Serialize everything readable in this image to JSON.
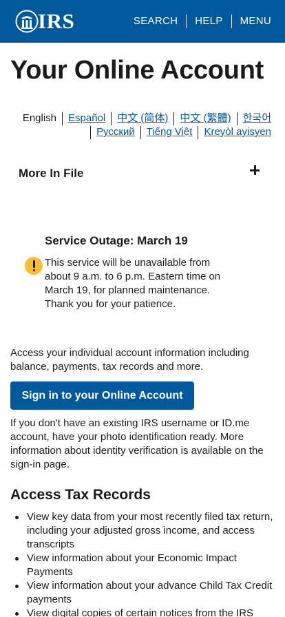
{
  "header": {
    "logo_text": "IRS",
    "logo_icon": "irs-eagle-logo",
    "nav": [
      "SEARCH",
      "HELP",
      "MENU"
    ],
    "brand_color": "#00599c"
  },
  "page": {
    "title": "Your Online Account"
  },
  "languages": {
    "current": "English",
    "row1_links": [
      "Español",
      "中文 (简体)",
      "中文 (繁體)",
      "한국어"
    ],
    "row2_links": [
      "Русский",
      "Tiếng Việt",
      "Kreyòl ayisyen"
    ]
  },
  "accordion": {
    "title": "More In File",
    "icon": "plus-icon"
  },
  "alert": {
    "icon": "exclamation-icon",
    "icon_color": "#ffbe2e",
    "heading": "Service Outage: March 19",
    "body": "This service will be unavailable from about 9 a.m. to 6 p.m. Eastern time on March 19, for planned maintenance. Thank you for your patience."
  },
  "intro": "Access your individual account information including balance, payments, tax records and more.",
  "signin_button": "Sign in to your Online Account",
  "help_text": "If you don't have an existing IRS username or ID.me account, have your photo identification ready. More information about identity verification is available on the sign-in page.",
  "tax_records": {
    "heading": "Access Tax Records",
    "items": [
      "View key data from your most recently filed tax return, including your adjusted gross income, and access transcripts",
      "View information about your Economic Impact Payments",
      "View information about your advance Child Tax Credit payments",
      "View digital copies of certain notices from the IRS"
    ]
  }
}
